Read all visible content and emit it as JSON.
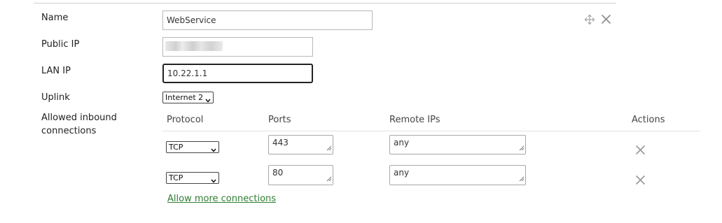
{
  "form": {
    "name_label": "Name",
    "name_value": "WebService",
    "public_ip_label": "Public IP",
    "lan_ip_label": "LAN IP",
    "lan_ip_value": "10.22.1.1",
    "uplink_label": "Uplink",
    "uplink_selected": "Internet 2",
    "allowed_label_line1": "Allowed inbound",
    "allowed_label_line2": "connections"
  },
  "toolbar_icons": {
    "move": "move-icon",
    "close": "close-icon"
  },
  "table": {
    "headers": {
      "protocol": "Protocol",
      "ports": "Ports",
      "remote_ips": "Remote IPs",
      "actions": "Actions"
    },
    "rows": [
      {
        "protocol": "TCP",
        "ports": "443",
        "remote_ips": "any"
      },
      {
        "protocol": "TCP",
        "ports": "80",
        "remote_ips": "any"
      }
    ]
  },
  "allow_more_link": "Allow more connections",
  "colors": {
    "link": "#2f7d32",
    "focus_border": "#222222"
  }
}
